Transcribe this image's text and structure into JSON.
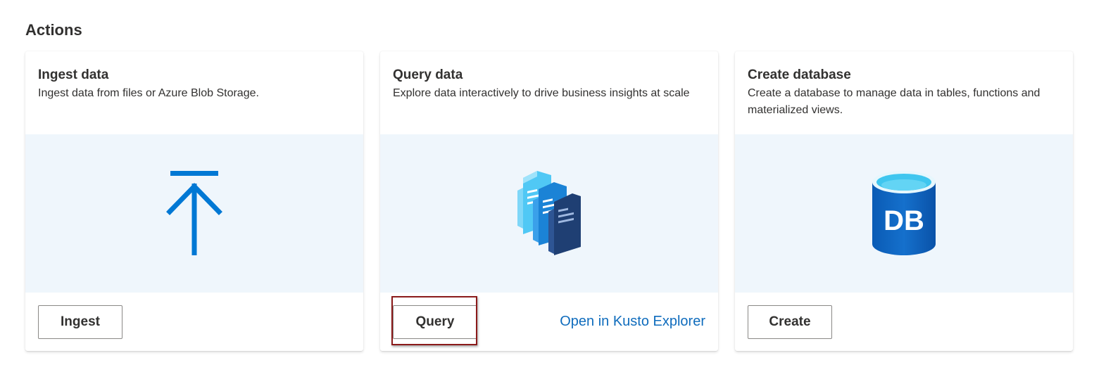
{
  "section": {
    "title": "Actions"
  },
  "cards": [
    {
      "title": "Ingest data",
      "description": "Ingest data from files or Azure Blob Storage.",
      "icon": "upload-arrow-icon",
      "button_label": "Ingest"
    },
    {
      "title": "Query data",
      "description": "Explore data interactively to drive business insights at scale",
      "icon": "query-documents-icon",
      "button_label": "Query",
      "link_label": "Open in Kusto Explorer"
    },
    {
      "title": "Create database",
      "description": "Create a database to manage data in tables, functions and materialized views.",
      "icon": "database-icon",
      "icon_text": "DB",
      "button_label": "Create"
    }
  ],
  "colors": {
    "art_background": "#eff6fc",
    "accent_blue": "#0078d4",
    "link_blue": "#0f6cbd",
    "highlight_red": "#8b1a1a"
  }
}
